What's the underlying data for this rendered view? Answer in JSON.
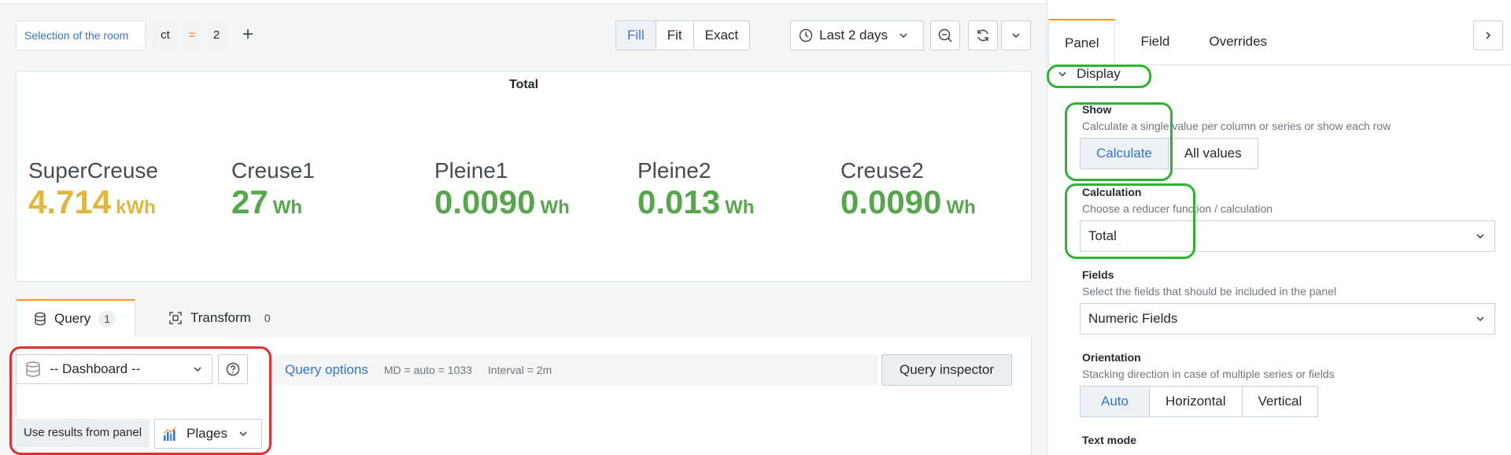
{
  "toolbar": {
    "var_label": "Selection of the room",
    "var_key": "ct",
    "var_op": "=",
    "var_value": "2",
    "add_label": "+",
    "display_modes": [
      "Fill",
      "Fit",
      "Exact"
    ],
    "active_mode": "Fill",
    "time_range": "Last 2 days"
  },
  "panel": {
    "title": "Total",
    "stats": [
      {
        "name": "SuperCreuse",
        "value": "4.714",
        "unit": "kWh",
        "color": "#e0b73a"
      },
      {
        "name": "Creuse1",
        "value": "27",
        "unit": "Wh",
        "color": "#56a64b"
      },
      {
        "name": "Pleine1",
        "value": "0.0090",
        "unit": "Wh",
        "color": "#56a64b"
      },
      {
        "name": "Pleine2",
        "value": "0.013",
        "unit": "Wh",
        "color": "#56a64b"
      },
      {
        "name": "Creuse2",
        "value": "0.0090",
        "unit": "Wh",
        "color": "#56a64b"
      }
    ]
  },
  "query_tabs": [
    {
      "label": "Query",
      "count": "1"
    },
    {
      "label": "Transform",
      "count": "0"
    }
  ],
  "query": {
    "datasource": "-- Dashboard --",
    "options_label": "Query options",
    "md_info": "MD = auto = 1033",
    "interval_info": "Interval = 2m",
    "inspector_label": "Query inspector",
    "use_results_label": "Use results from panel",
    "panel_name": "Plages"
  },
  "options": {
    "tabs": [
      "Panel",
      "Field",
      "Overrides"
    ],
    "active_tab": "Panel",
    "section": "Display",
    "show": {
      "label": "Show",
      "desc": "Calculate a single value per column or series or show each row",
      "choices": [
        "Calculate",
        "All values"
      ],
      "active": "Calculate"
    },
    "calculation": {
      "label": "Calculation",
      "desc": "Choose a reducer function / calculation",
      "value": "Total"
    },
    "fields": {
      "label": "Fields",
      "desc": "Select the fields that should be included in the panel",
      "value": "Numeric Fields"
    },
    "orientation": {
      "label": "Orientation",
      "desc": "Stacking direction in case of multiple series or fields",
      "choices": [
        "Auto",
        "Horizontal",
        "Vertical"
      ],
      "active": "Auto"
    },
    "text_mode": {
      "label": "Text mode"
    }
  }
}
